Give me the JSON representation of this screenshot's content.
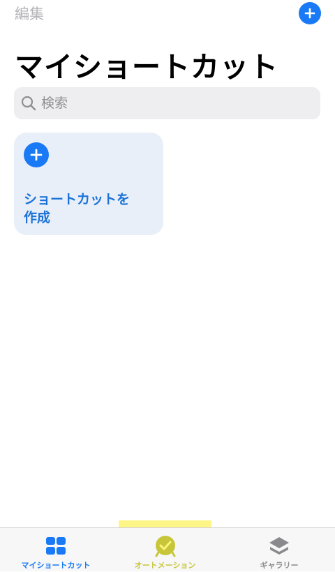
{
  "header": {
    "edit_label": "編集",
    "add_icon": "plus-circle-icon",
    "title": "マイショートカット"
  },
  "search": {
    "placeholder": "検索",
    "value": "",
    "icon": "search-icon"
  },
  "card": {
    "label_line1": "ショートカットを",
    "label_line2": "作成",
    "icon": "plus-circle-icon",
    "bg_color": "#e9eff8",
    "accent_color": "#1a72d9"
  },
  "tabs": [
    {
      "label": "マイショートカット",
      "icon": "grid-icon",
      "selected": true
    },
    {
      "label": "オートメーション",
      "icon": "clock-check-icon",
      "selected": false
    },
    {
      "label": "ギャラリー",
      "icon": "layers-icon",
      "selected": false
    }
  ],
  "colors": {
    "accent": "#1a7af5",
    "highlight": "#fdf57a"
  }
}
